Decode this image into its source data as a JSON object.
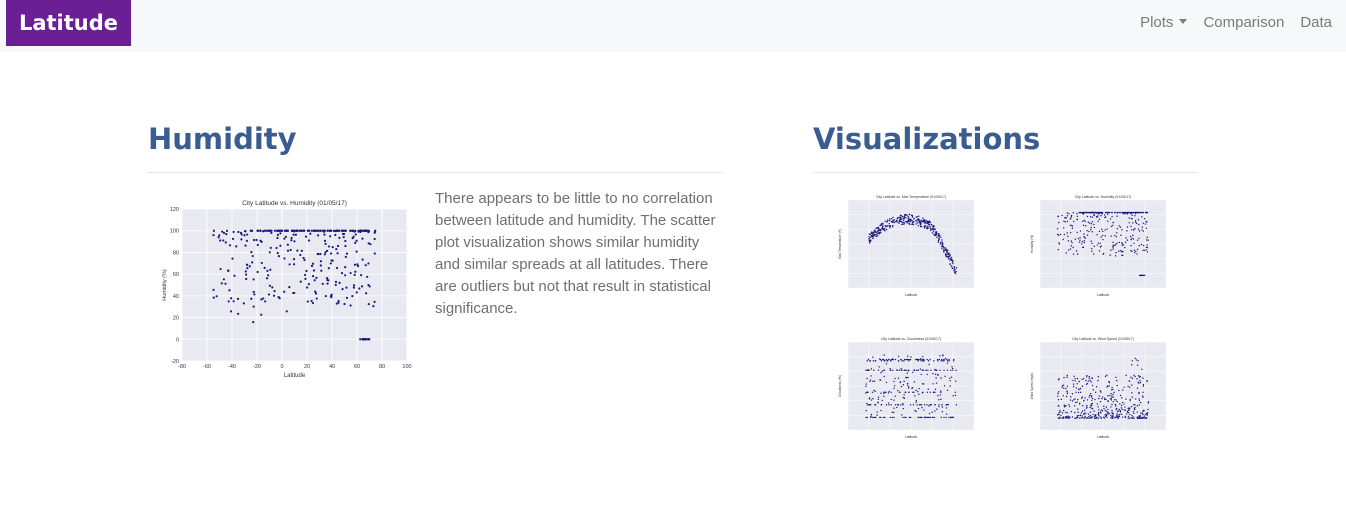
{
  "navbar": {
    "brand": "Latitude",
    "links": [
      "Plots",
      "Comparison",
      "Data"
    ]
  },
  "main": {
    "title": "Humidity",
    "description": "There appears to be little to no correlation between latitude and humidity. The scatter plot visualization shows similar humidity and similar spreads at all latitudes. There are outliers but not that result in statistical significance."
  },
  "sidebar": {
    "title": "Visualizations"
  },
  "colors": {
    "brand": "#6a1f94",
    "heading": "#3a5d91",
    "point": "#1a1a7a",
    "plot_bg": "#e9e9f2"
  },
  "chart_data": [
    {
      "type": "scatter",
      "title": "City Latitude vs. Humidity (01/05/17)",
      "xlabel": "Latitude",
      "ylabel": "Humidity (%)",
      "xlim": [
        -80,
        100
      ],
      "ylim": [
        -20,
        120
      ],
      "xticks": [
        -80,
        -60,
        -40,
        -20,
        0,
        20,
        40,
        60,
        80,
        100
      ],
      "yticks": [
        -20,
        0,
        20,
        40,
        60,
        80,
        100,
        120
      ],
      "grid": true,
      "note": "Several hundred cities; most humidity values 40-100%, a band at 100%, a cluster near 0% around latitude 62-70."
    },
    {
      "type": "scatter",
      "title": "City Latitude vs. Max Temperature (01/05/17)",
      "xlabel": "Latitude",
      "ylabel": "Max Temperature (F)"
    },
    {
      "type": "scatter",
      "title": "City Latitude vs. Humidity (01/05/17)",
      "xlabel": "Latitude",
      "ylabel": "Humidity (%)"
    },
    {
      "type": "scatter",
      "title": "City Latitude vs. Cloudiness (01/05/17)",
      "xlabel": "Latitude",
      "ylabel": "Cloudiness (%)"
    },
    {
      "type": "scatter",
      "title": "City Latitude vs. Wind Speed (01/05/17)",
      "xlabel": "Latitude",
      "ylabel": "Wind Speed (mph)"
    }
  ]
}
